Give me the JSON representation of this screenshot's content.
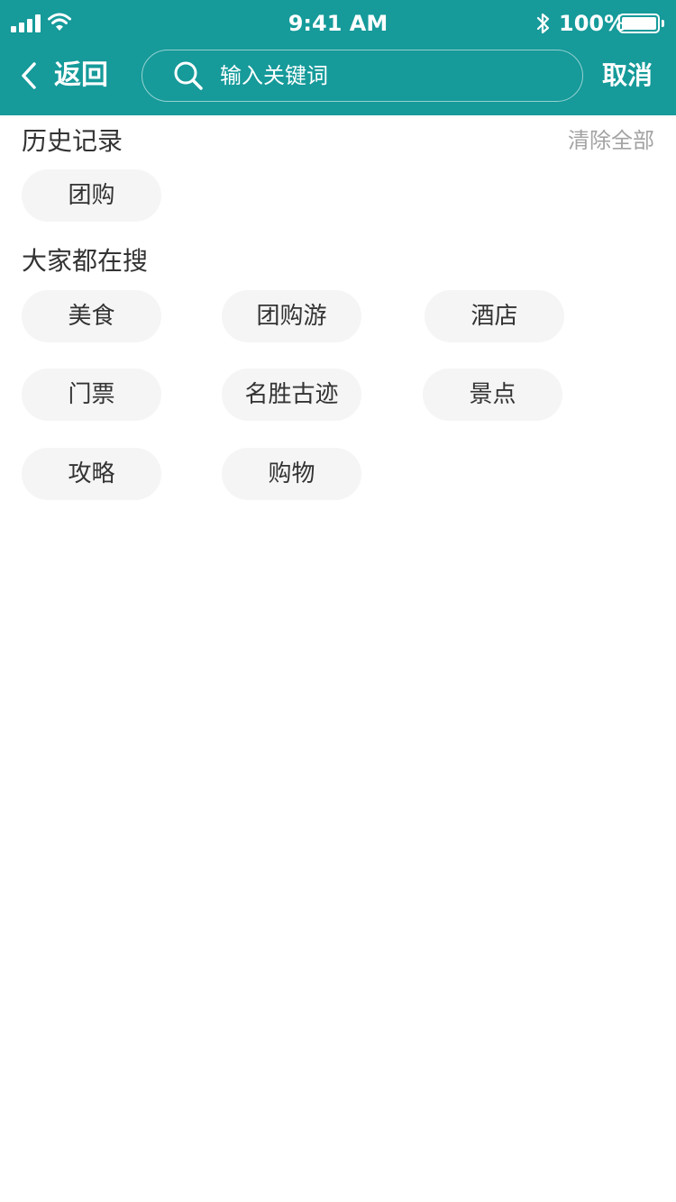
{
  "status_bar": {
    "time": "9:41 AM",
    "battery": "100%"
  },
  "nav": {
    "back_label": "返回",
    "search_placeholder": "输入关键词",
    "cancel_label": "取消"
  },
  "history": {
    "title": "历史记录",
    "clear_label": "清除全部",
    "items": [
      "团购"
    ]
  },
  "popular": {
    "title": "大家都在搜",
    "items": [
      "美食",
      "团购游",
      "酒店",
      "门票",
      "名胜古迹",
      "景点",
      "攻略",
      "购物"
    ]
  },
  "colors": {
    "header_bg": "#169a9a",
    "tag_bg": "#f5f5f5",
    "text": "#333333",
    "muted": "#a3a3a3"
  }
}
